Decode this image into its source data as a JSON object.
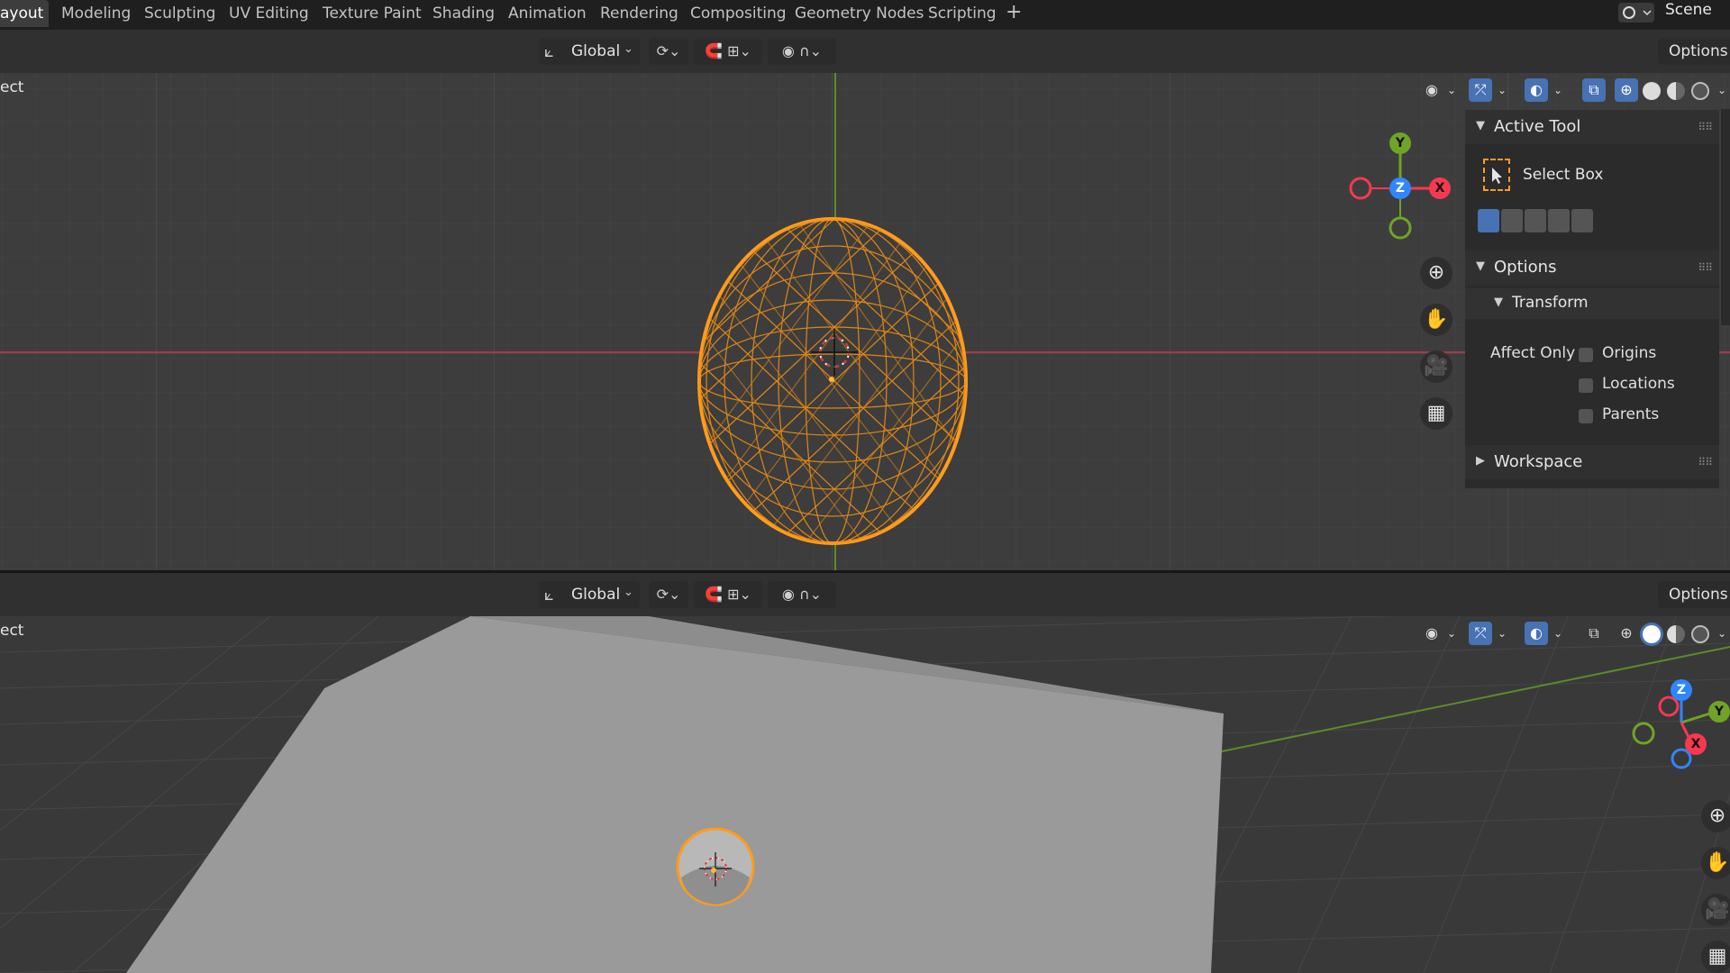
{
  "workspace_tabs": [
    {
      "label": "ayout",
      "active": true
    },
    {
      "label": "Modeling"
    },
    {
      "label": "Sculpting"
    },
    {
      "label": "UV Editing"
    },
    {
      "label": "Texture Paint"
    },
    {
      "label": "Shading"
    },
    {
      "label": "Animation"
    },
    {
      "label": "Rendering"
    },
    {
      "label": "Compositing"
    },
    {
      "label": "Geometry Nodes"
    },
    {
      "label": "Scripting"
    }
  ],
  "add_tab": "+",
  "scene": {
    "label": "Scene",
    "icon": "scene-icon"
  },
  "header": {
    "transform_orientation": "Global",
    "options_label": "Options"
  },
  "viewport_top": {
    "mode_label": "ect",
    "gizmo": {
      "x": "X",
      "y": "Y",
      "z": "Z"
    },
    "object": "sphere-wireframe-selected"
  },
  "viewport_bottom": {
    "mode_label": "ect",
    "gizmo": {
      "x": "X",
      "y": "Y",
      "z": "Z"
    },
    "object": "sphere-on-plane-selected"
  },
  "tool_panel": {
    "active_tool_title": "Active Tool",
    "tool_name": "Select Box",
    "options_title": "Options",
    "transform_title": "Transform",
    "affect_only_label": "Affect Only",
    "checkboxes": [
      {
        "label": "Origins",
        "checked": false
      },
      {
        "label": "Locations",
        "checked": false
      },
      {
        "label": "Parents",
        "checked": false
      }
    ],
    "workspace_title": "Workspace"
  },
  "colors": {
    "accent_blue": "#4772b3",
    "selected_orange": "#ff9c1d",
    "axis_red": "#f73850",
    "axis_green": "#6fa426",
    "axis_blue": "#2f86ff"
  }
}
